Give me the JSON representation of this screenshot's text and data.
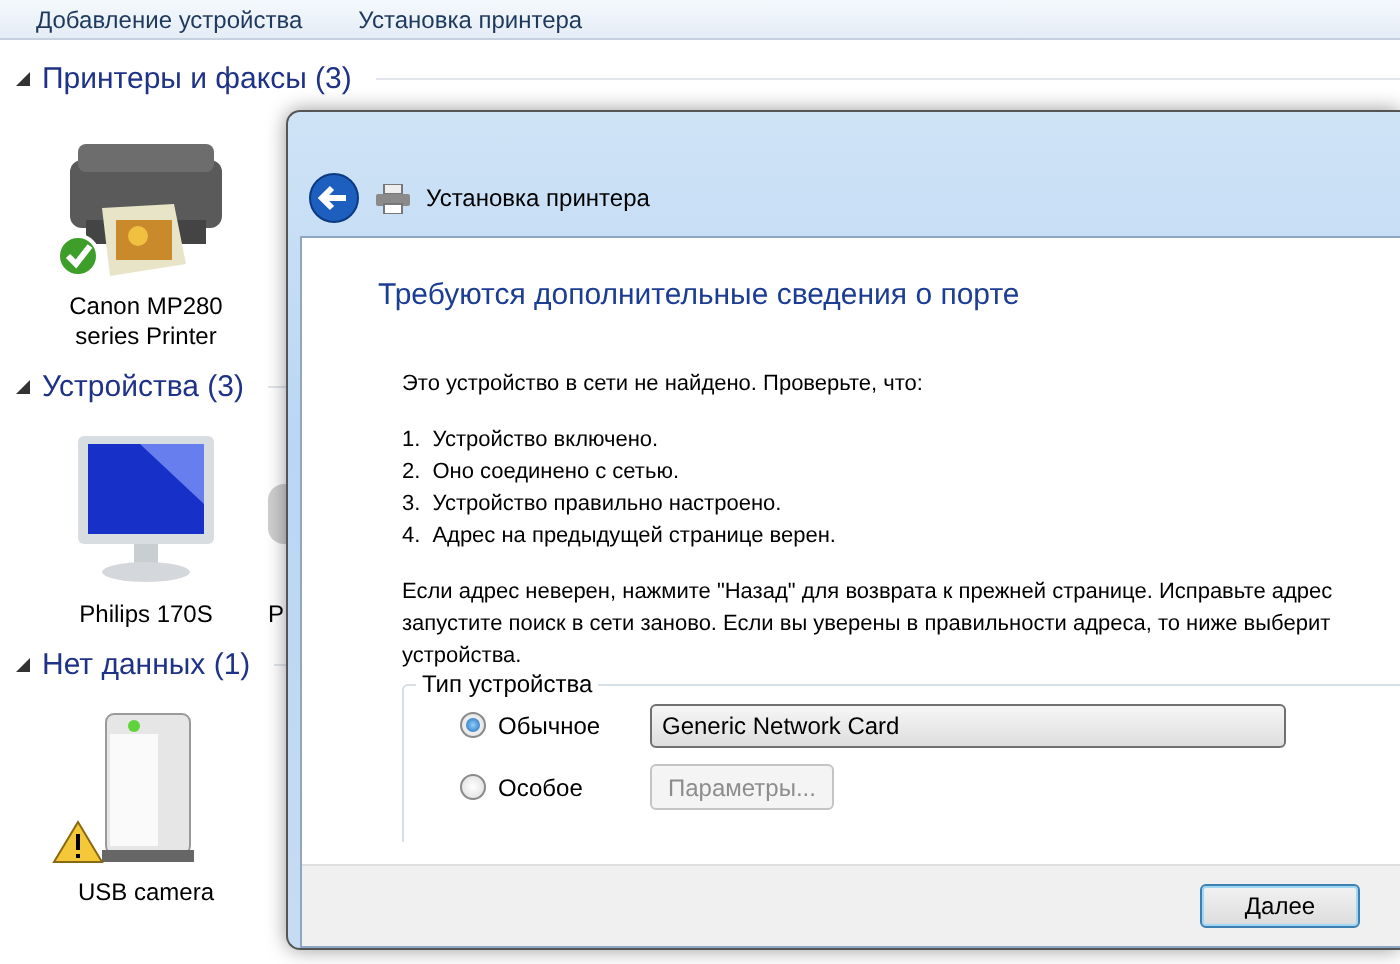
{
  "toolbar": [
    {
      "label": "Добавление устройства"
    },
    {
      "label": "Установка принтера"
    }
  ],
  "sections": [
    {
      "title": "Принтеры и факсы (3)",
      "expanded": true,
      "devices": [
        {
          "name": "Canon MP280 series Printer",
          "kind": "printer",
          "ready": true,
          "warning": false
        }
      ]
    },
    {
      "title": "Устройства (3)",
      "expanded": true,
      "devices": [
        {
          "name": "Philips 170S",
          "kind": "monitor",
          "ready": false,
          "warning": false
        },
        {
          "name": "P",
          "kind": "other",
          "ready": false,
          "warning": false
        }
      ]
    },
    {
      "title": "Нет данных (1)",
      "expanded": true,
      "devices": [
        {
          "name": "USB camera",
          "kind": "tower",
          "ready": false,
          "warning": true
        }
      ]
    }
  ],
  "dialog": {
    "title": "Установка принтера",
    "heading": "Требуются дополнительные сведения о порте",
    "intro": "Это устройство в сети не найдено. Проверьте, что:",
    "checklist": [
      {
        "number": "1.",
        "text": "Устройство включено."
      },
      {
        "number": "2.",
        "text": "Оно соединено с сетью."
      },
      {
        "number": "3.",
        "text": "Устройство правильно настроено."
      },
      {
        "number": "4.",
        "text": "Адрес на предыдущей странице верен."
      }
    ],
    "paragraph_lines": [
      "Если адрес неверен, нажмите \"Назад\" для возврата к прежней странице.  Исправьте адрес",
      "запустите поиск в сети заново.  Если вы уверены в правильности адреса, то ниже выберит",
      "устройства."
    ],
    "device_type": {
      "legend": "Тип устройства",
      "options": [
        {
          "label": "Обычное",
          "selected": true,
          "control": {
            "kind": "dropdown",
            "value": "Generic Network Card"
          }
        },
        {
          "label": "Особое",
          "selected": false,
          "control": {
            "kind": "button",
            "label": "Параметры...",
            "disabled": true
          }
        }
      ]
    },
    "buttons": [
      {
        "label": "Далее",
        "default": true
      }
    ]
  }
}
